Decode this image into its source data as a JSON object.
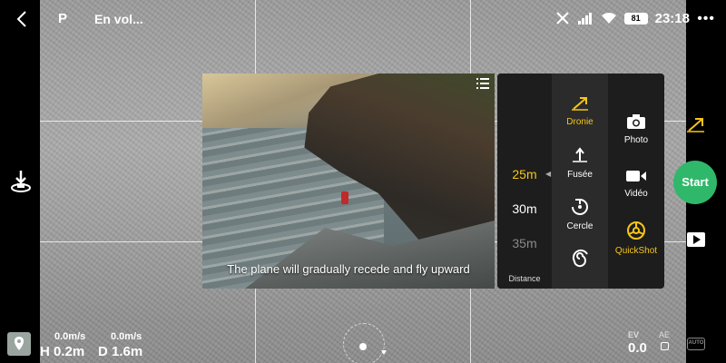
{
  "topbar": {
    "mode": "P",
    "flight_status": "En vol...",
    "battery_percent": "81",
    "clock": "23:18",
    "icons": [
      "back-chevron-icon",
      "satellite-icon",
      "signal-icon",
      "wifi-icon",
      "battery-icon",
      "more-dots-icon"
    ]
  },
  "preview": {
    "caption": "The plane will gradually recede and fly upward"
  },
  "quickshot": {
    "distance": {
      "values": [
        "25m",
        "30m",
        "35m"
      ],
      "selected": "25m",
      "label": "Distance"
    },
    "modes": [
      {
        "label": "Dronie",
        "icon": "dronie-icon",
        "selected": true
      },
      {
        "label": "Fusée",
        "icon": "rocket-icon",
        "selected": false
      },
      {
        "label": "Cercle",
        "icon": "circle-icon",
        "selected": false
      },
      {
        "label": "",
        "icon": "helix-icon",
        "selected": false
      }
    ],
    "types": [
      {
        "label": "Photo",
        "icon": "camera-icon",
        "selected": false
      },
      {
        "label": "Vidéo",
        "icon": "video-icon",
        "selected": false
      },
      {
        "label": "QuickShot",
        "icon": "quickshot-icon",
        "selected": true
      }
    ]
  },
  "telemetry": {
    "h_speed": "0.0m/s",
    "v_speed": "0.0m/s",
    "height": "H 0.2m",
    "distance": "D 1.6m"
  },
  "right": {
    "start_label": "Start",
    "ev_label": "EV",
    "ev_value": "0.0",
    "ae_label": "AE",
    "auto_label": "AUTO"
  },
  "colors": {
    "accent_yellow": "#f5c518",
    "start_green": "#2fb86a",
    "panel_dark": "#2b2b2b",
    "panel_darker": "#1d1d1d"
  }
}
